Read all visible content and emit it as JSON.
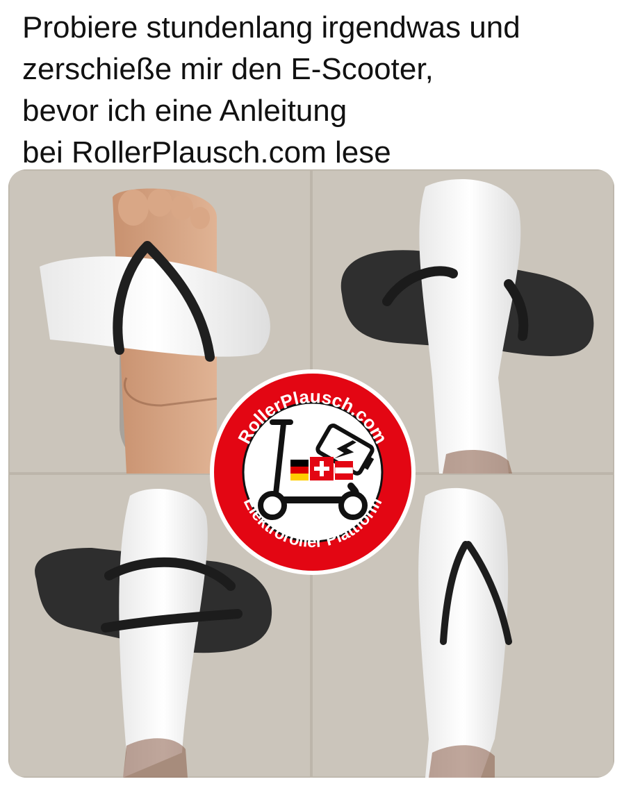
{
  "caption": {
    "lines": [
      "Probiere stundenlang irgendwas und",
      "zerschieße mir den E-Scooter,",
      "bevor ich eine Anleitung",
      "bei RollerPlausch.com lese"
    ]
  },
  "photo": {
    "panels": [
      "flip-flop-over-sock-on-bare-foot",
      "flip-flop-strap-on-white-sock",
      "flip-flop-under-white-sock",
      "flip-flop-strap-drawn-on-white-sock"
    ]
  },
  "logo": {
    "top_text": "RollerPlausch.com",
    "bottom_text": "Elektroroller Plattform",
    "ring_color": "#e30613",
    "icon": "e-scooter-battery-flag-icon"
  }
}
